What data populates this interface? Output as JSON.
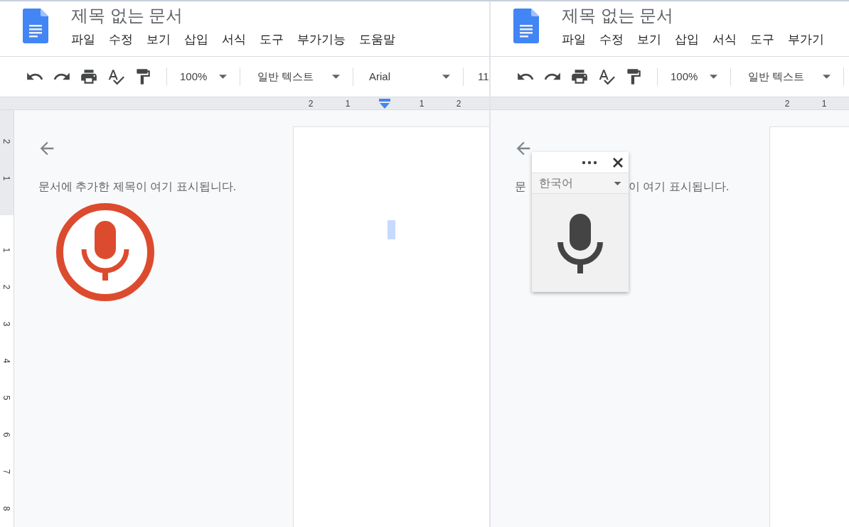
{
  "panels": [
    {
      "title": "제목 없는 문서",
      "menu": [
        "파일",
        "수정",
        "보기",
        "삽입",
        "서식",
        "도구",
        "부가기능",
        "도움말"
      ],
      "zoom": "100%",
      "style": "일반 텍스트",
      "font": "Arial",
      "font_size": "11",
      "ruler": [
        {
          "kind": "number",
          "label": "2"
        },
        {
          "kind": "number",
          "label": "1"
        },
        {
          "kind": "indent_marker"
        },
        {
          "kind": "number",
          "label": "1"
        },
        {
          "kind": "number",
          "label": "2"
        }
      ],
      "vertical_ruler": {
        "above": [
          "2",
          "1"
        ],
        "below": [
          "1",
          "2",
          "3",
          "4",
          "5",
          "6",
          "7",
          "8"
        ]
      },
      "outline_text": [
        "문서에 추가한 제목이 여기 표시됩니다."
      ],
      "cursor": true,
      "voice": {
        "kind": "mic_button"
      }
    },
    {
      "title": "제목 없는 문서",
      "menu": [
        "파일",
        "수정",
        "보기",
        "삽입",
        "서식",
        "도구",
        "부가기"
      ],
      "zoom": "100%",
      "style": "일반 텍스트",
      "ruler": [
        {
          "kind": "number",
          "label": "2"
        },
        {
          "kind": "number",
          "label": "1"
        }
      ],
      "outline_text": [
        "문",
        "이 여기 표시됩니다."
      ],
      "voice": {
        "kind": "widget",
        "language": "한국어"
      }
    }
  ]
}
